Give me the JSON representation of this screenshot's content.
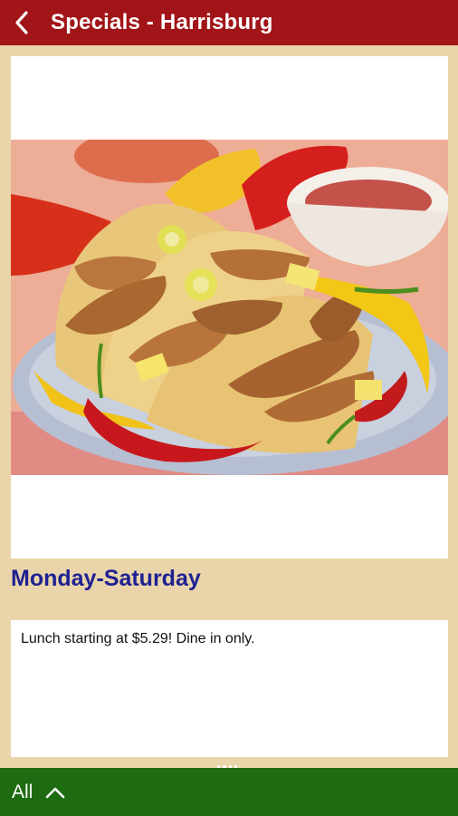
{
  "appbar": {
    "title": "Specials - Harrisburg",
    "back_icon": "chevron-left-icon",
    "background": "#a11418"
  },
  "special": {
    "image_alt": "Grilled chicken tacos with peppers",
    "heading": "Monday-Saturday",
    "description": "Lunch starting at $5.29! Dine in only."
  },
  "bottom_bar": {
    "filter_label": "All",
    "expand_icon": "chevron-up-icon",
    "background": "#1e6b12"
  },
  "colors": {
    "page_background": "#ead5ab",
    "heading": "#1f2191"
  }
}
